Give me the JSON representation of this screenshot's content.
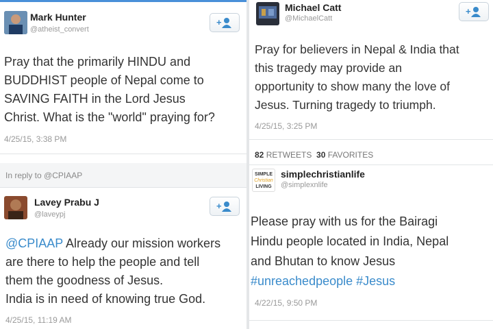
{
  "tweets": [
    {
      "name": "Mark Hunter",
      "handle": "@atheist_convert",
      "lines": [
        "Pray that the primarily HINDU and",
        "BUDDHIST people of Nepal come to",
        "SAVING FAITH in the Lord Jesus",
        "Christ. What is the \"world\" praying for?"
      ],
      "time": "4/25/15, 3:38 PM"
    },
    {
      "reply_to": "In reply to @CPIAAP",
      "name": "Lavey Prabu J",
      "handle": "@laveypj",
      "mention": "@CPIAAP",
      "line1_rest": " Already our mission workers",
      "lines": [
        "are there to help the people and tell",
        "them the goodness of Jesus.",
        "India is in need of knowing true God."
      ],
      "time": "4/25/15, 11:19 AM"
    },
    {
      "name": "Michael Catt",
      "handle": "@MichaelCatt",
      "lines": [
        "Pray for believers in Nepal & India that",
        "this tragedy may provide an",
        "opportunity to show many the love of",
        "Jesus. Turning tragedy to triumph."
      ],
      "time": "4/25/15, 3:25 PM",
      "retweets": "82",
      "retweets_label": "RETWEETS",
      "favorites": "30",
      "favorites_label": "FAVORITES"
    },
    {
      "name": "simplechristianlife",
      "handle": "@simplexnlife",
      "avatar_text": [
        "SIMPLE",
        "Christian",
        "LIVING"
      ],
      "lines": [
        "Please pray with us for the Bairagi",
        "Hindu people located in India, Nepal",
        "and Bhutan to know Jesus"
      ],
      "hashtags": "#unreachedpeople #Jesus",
      "time": "4/22/15, 9:50 PM"
    }
  ],
  "colors": {
    "link": "#3a8bcb",
    "follow_icon": "#3a8bcb"
  },
  "icons": {
    "follow": "add-user-icon"
  }
}
